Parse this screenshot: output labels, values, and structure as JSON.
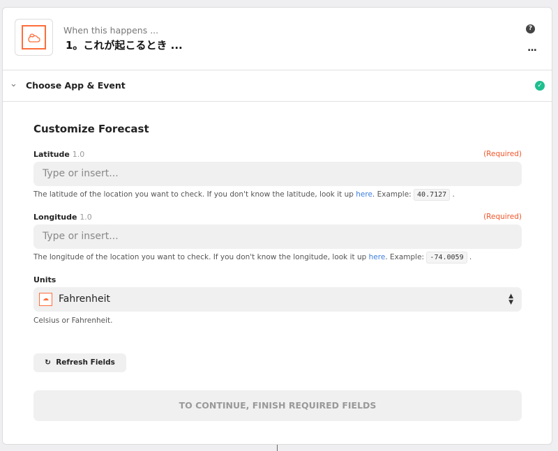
{
  "header": {
    "subtitle": "When this happens ...",
    "title": "1。これが起こるとき ...",
    "app_icon": "weather-cloud-sun-icon",
    "help": "?",
    "more": "..."
  },
  "section": {
    "label": "Choose App & Event",
    "status": "complete",
    "chevron": "⌄"
  },
  "form": {
    "title": "Customize Forecast",
    "latitude": {
      "label": "Latitude",
      "version": "1.0",
      "required": "(Required)",
      "placeholder": "Type or insert...",
      "help_pre": "The latitude of the location you want to check. If you don't know the latitude, look it up ",
      "link": "here",
      "help_mid": ". Example: ",
      "example": "40.7127",
      "help_post": " ."
    },
    "longitude": {
      "label": "Longitude",
      "version": "1.0",
      "required": "(Required)",
      "placeholder": "Type or insert...",
      "help_pre": "The longitude of the location you want to check. If you don't know the longitude, look it up ",
      "link": "here",
      "help_mid": ". Example: ",
      "example": "-74.0059",
      "help_post": " ."
    },
    "units": {
      "label": "Units",
      "value": "Fahrenheit",
      "help": "Celsius or Fahrenheit."
    },
    "refresh": "Refresh Fields",
    "continue": "TO CONTINUE, FINISH REQUIRED FIELDS"
  },
  "colors": {
    "accent": "#ff6d3a",
    "required": "#f0562a",
    "success": "#1fbf8f",
    "link": "#3b7ddd"
  }
}
